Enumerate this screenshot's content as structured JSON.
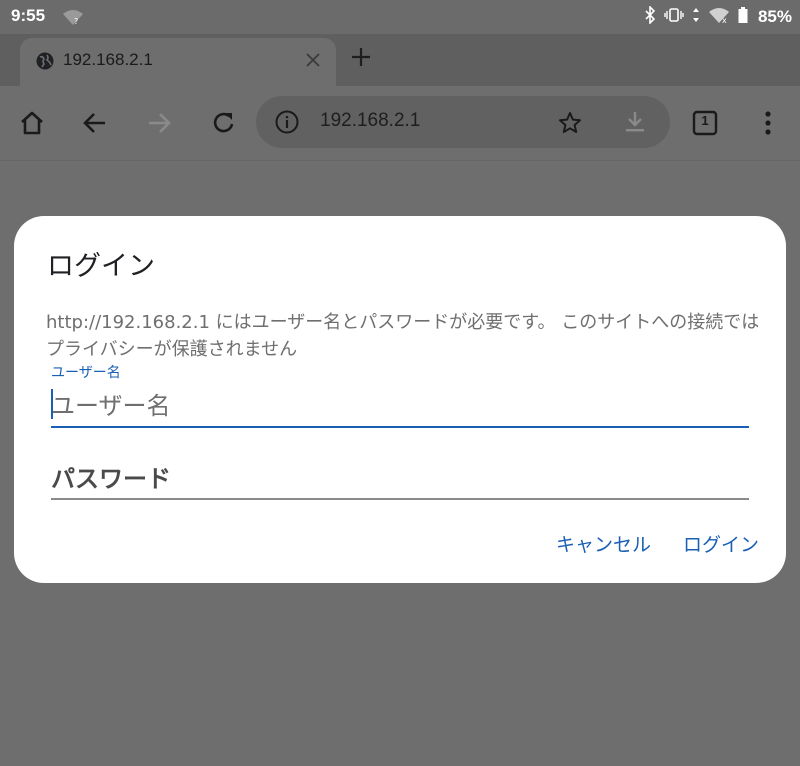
{
  "status_bar": {
    "time": "9:55",
    "battery_percent": "85%"
  },
  "tab": {
    "title": "192.168.2.1"
  },
  "toolbar": {
    "url": "192.168.2.1",
    "tab_count": "1"
  },
  "dialog": {
    "title": "ログイン",
    "message": "http://192.168.2.1 にはユーザー名とパスワードが必要です。 このサイトへの接続ではプライバシーが保護されません",
    "username_label": "ユーザー名",
    "username_placeholder": "ユーザー名",
    "password_placeholder": "パスワード",
    "cancel_label": "キャンセル",
    "login_label": "ログイン"
  },
  "colors": {
    "accent": "#1a5fb4",
    "scrim": "#6e6e6e",
    "dialog_bg": "#ffffff"
  },
  "icons": [
    "home-icon",
    "back-icon",
    "forward-icon",
    "reload-icon",
    "info-icon",
    "star-icon",
    "download-icon",
    "tab-switcher-icon",
    "menu-icon"
  ]
}
